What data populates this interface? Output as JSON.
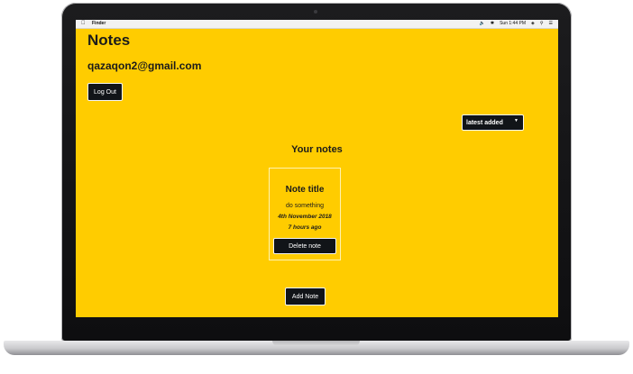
{
  "menubar": {
    "apple_icon": "apple-icon",
    "app_name": "Finder",
    "clock": "Sun 1:44 PM"
  },
  "app": {
    "title": "Notes",
    "user_email": "qazaqon2@gmail.com",
    "logout_label": "Log Out",
    "sort_selected": "latest added",
    "section_title": "Your notes",
    "add_note_label": "Add Note"
  },
  "notes": [
    {
      "title": "Note title",
      "body": "do something",
      "date": "4th November 2018",
      "age": "7 hours ago",
      "delete_label": "Delete note"
    }
  ],
  "colors": {
    "background": "#ffcc00",
    "button": "#111418",
    "text": "#1b1b1b"
  }
}
